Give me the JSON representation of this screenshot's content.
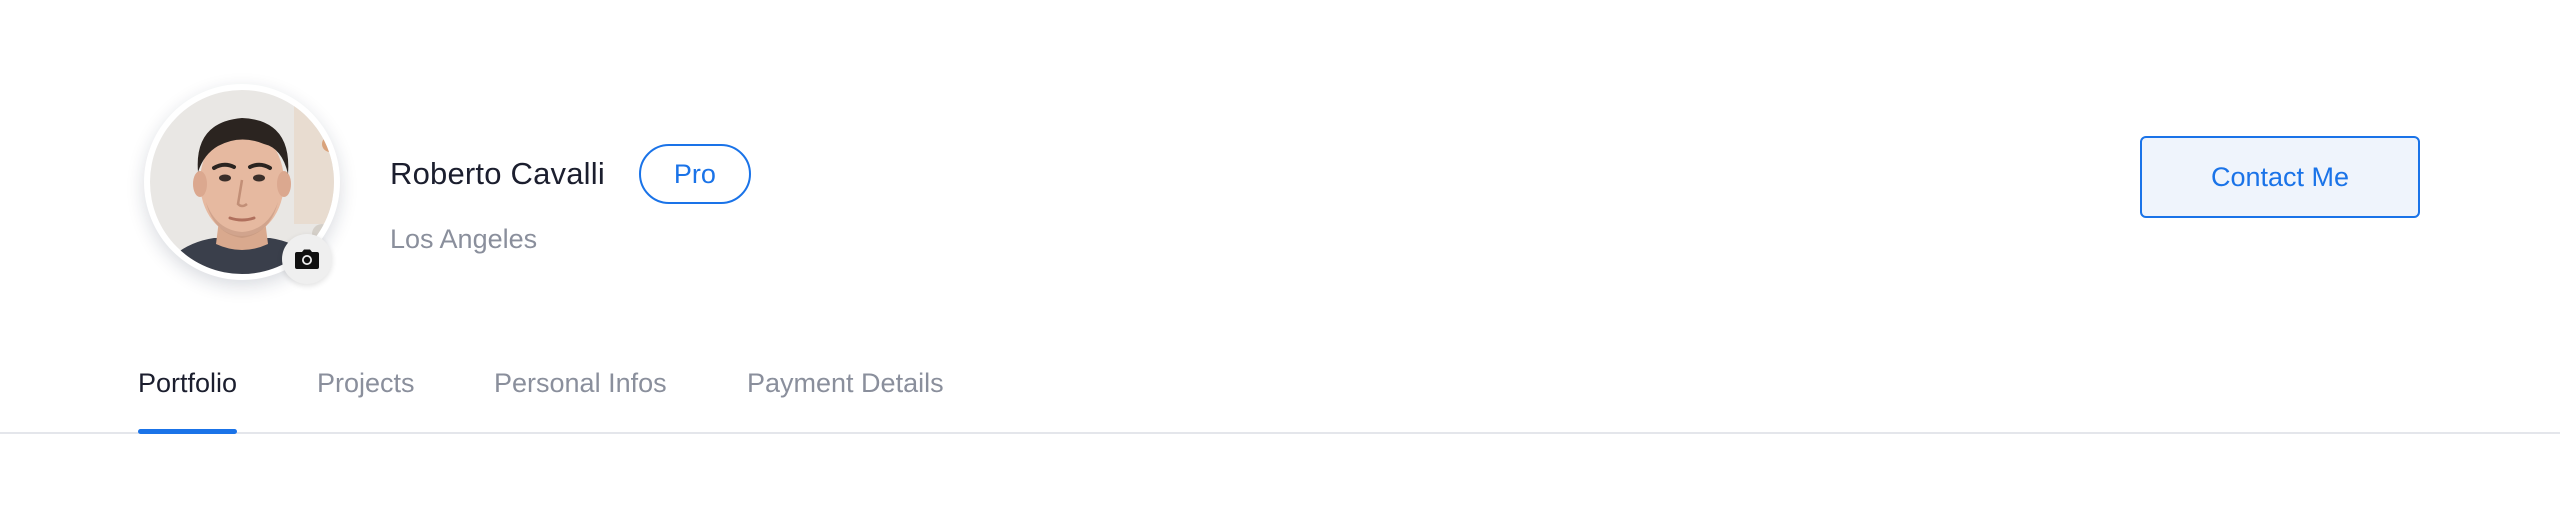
{
  "profile": {
    "name": "Roberto Cavalli",
    "badge": "Pro",
    "location": "Los Angeles",
    "avatar_icon": "user-photo",
    "change_photo_icon": "camera-icon"
  },
  "actions": {
    "contact_label": "Contact Me"
  },
  "tabs": [
    {
      "label": "Portfolio",
      "active": true
    },
    {
      "label": "Projects",
      "active": false
    },
    {
      "label": "Personal Infos",
      "active": false
    },
    {
      "label": "Payment Details",
      "active": false
    }
  ],
  "colors": {
    "accent": "#1a73e8",
    "text_primary": "#1b1e2e",
    "text_muted": "#8a8f9c",
    "button_bg": "#eff4fc",
    "divider": "#e4e6eb"
  }
}
